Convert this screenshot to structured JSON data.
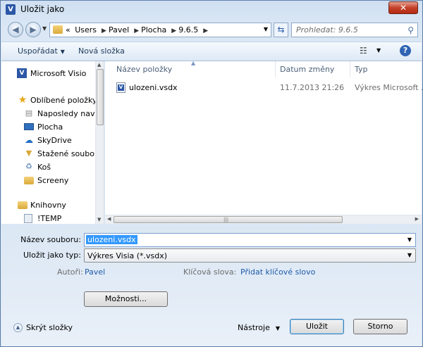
{
  "window": {
    "title": "Uložit jako",
    "close": "✕"
  },
  "address": {
    "prefix": "«",
    "crumbs": [
      "Users",
      "Pavel",
      "Plocha",
      "9.6.5"
    ],
    "search_placeholder": "Prohledat: 9.6.5"
  },
  "toolbar": {
    "organize": "Uspořádat",
    "new_folder": "Nová složka",
    "help": "?"
  },
  "nav": {
    "items": [
      {
        "label": "Microsoft Visio",
        "icon": "visio-icon"
      },
      {
        "label": "Oblíbené položky",
        "icon": "star-icon"
      },
      {
        "label": "Naposledy navštívené",
        "icon": "recent-places-icon"
      },
      {
        "label": "Plocha",
        "icon": "desktop-icon"
      },
      {
        "label": "SkyDrive",
        "icon": "skydrive-icon"
      },
      {
        "label": "Stažené soubory",
        "icon": "downloads-icon"
      },
      {
        "label": "Koš",
        "icon": "recycle-bin-icon"
      },
      {
        "label": "Screeny",
        "icon": "folder-icon"
      },
      {
        "label": "Knihovny",
        "icon": "libraries-icon"
      },
      {
        "label": "!TEMP",
        "icon": "library-folder-icon"
      }
    ]
  },
  "columns": {
    "name": "Název položky",
    "date": "Datum změny",
    "type": "Typ"
  },
  "files": [
    {
      "name": "ulozeni.vsdx",
      "date": "11.7.2013 21:26",
      "type": "Výkres Microsoft ..."
    }
  ],
  "form": {
    "filename_label": "Název souboru:",
    "filename_value": "ulozeni.vsdx",
    "type_label": "Uložit jako typ:",
    "type_value": "Výkres Visia (*.vsdx)",
    "authors_label": "Autoři:",
    "authors_value": "Pavel",
    "keywords_label": "Klíčová slova:",
    "keywords_value": "Přidat klíčové slovo",
    "options_button": "Možnosti...",
    "hide_folders": "Skrýt složky",
    "tools": "Nástroje",
    "save": "Uložit",
    "cancel": "Storno"
  }
}
